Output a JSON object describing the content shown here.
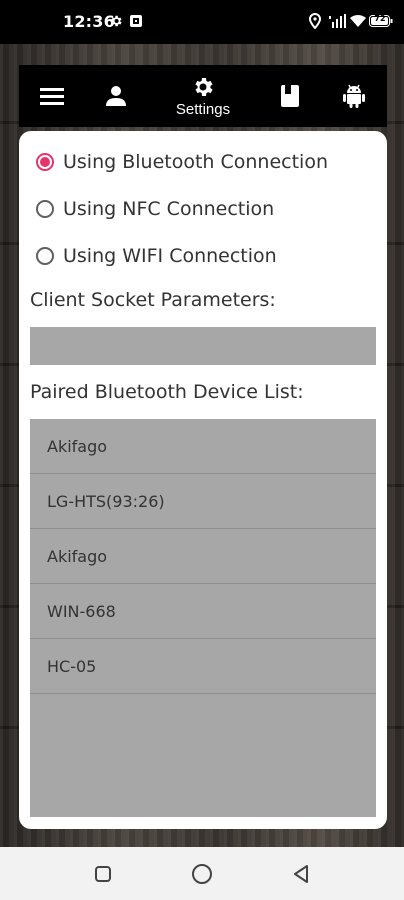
{
  "status_bar": {
    "time": "12:36",
    "battery": "72"
  },
  "toolbar": {
    "settings_label": "Settings",
    "icons": [
      "menu-icon",
      "person-icon",
      "gear-icon",
      "book-icon",
      "android-icon"
    ]
  },
  "connection_options": [
    {
      "label": "Using Bluetooth Connection",
      "checked": true
    },
    {
      "label": "Using NFC Connection",
      "checked": false
    },
    {
      "label": "Using WIFI Connection",
      "checked": false
    }
  ],
  "client_socket": {
    "label": "Client Socket Parameters:",
    "value": ""
  },
  "paired_devices": {
    "label": "Paired Bluetooth Device List:",
    "items": [
      "Akifago",
      "LG-HTS(93:26)",
      "Akifago",
      "WIN-668",
      "HC-05"
    ]
  },
  "colors": {
    "accent": "#e5336b",
    "field_gray": "#a7a7a7",
    "bar_black": "#000000"
  }
}
